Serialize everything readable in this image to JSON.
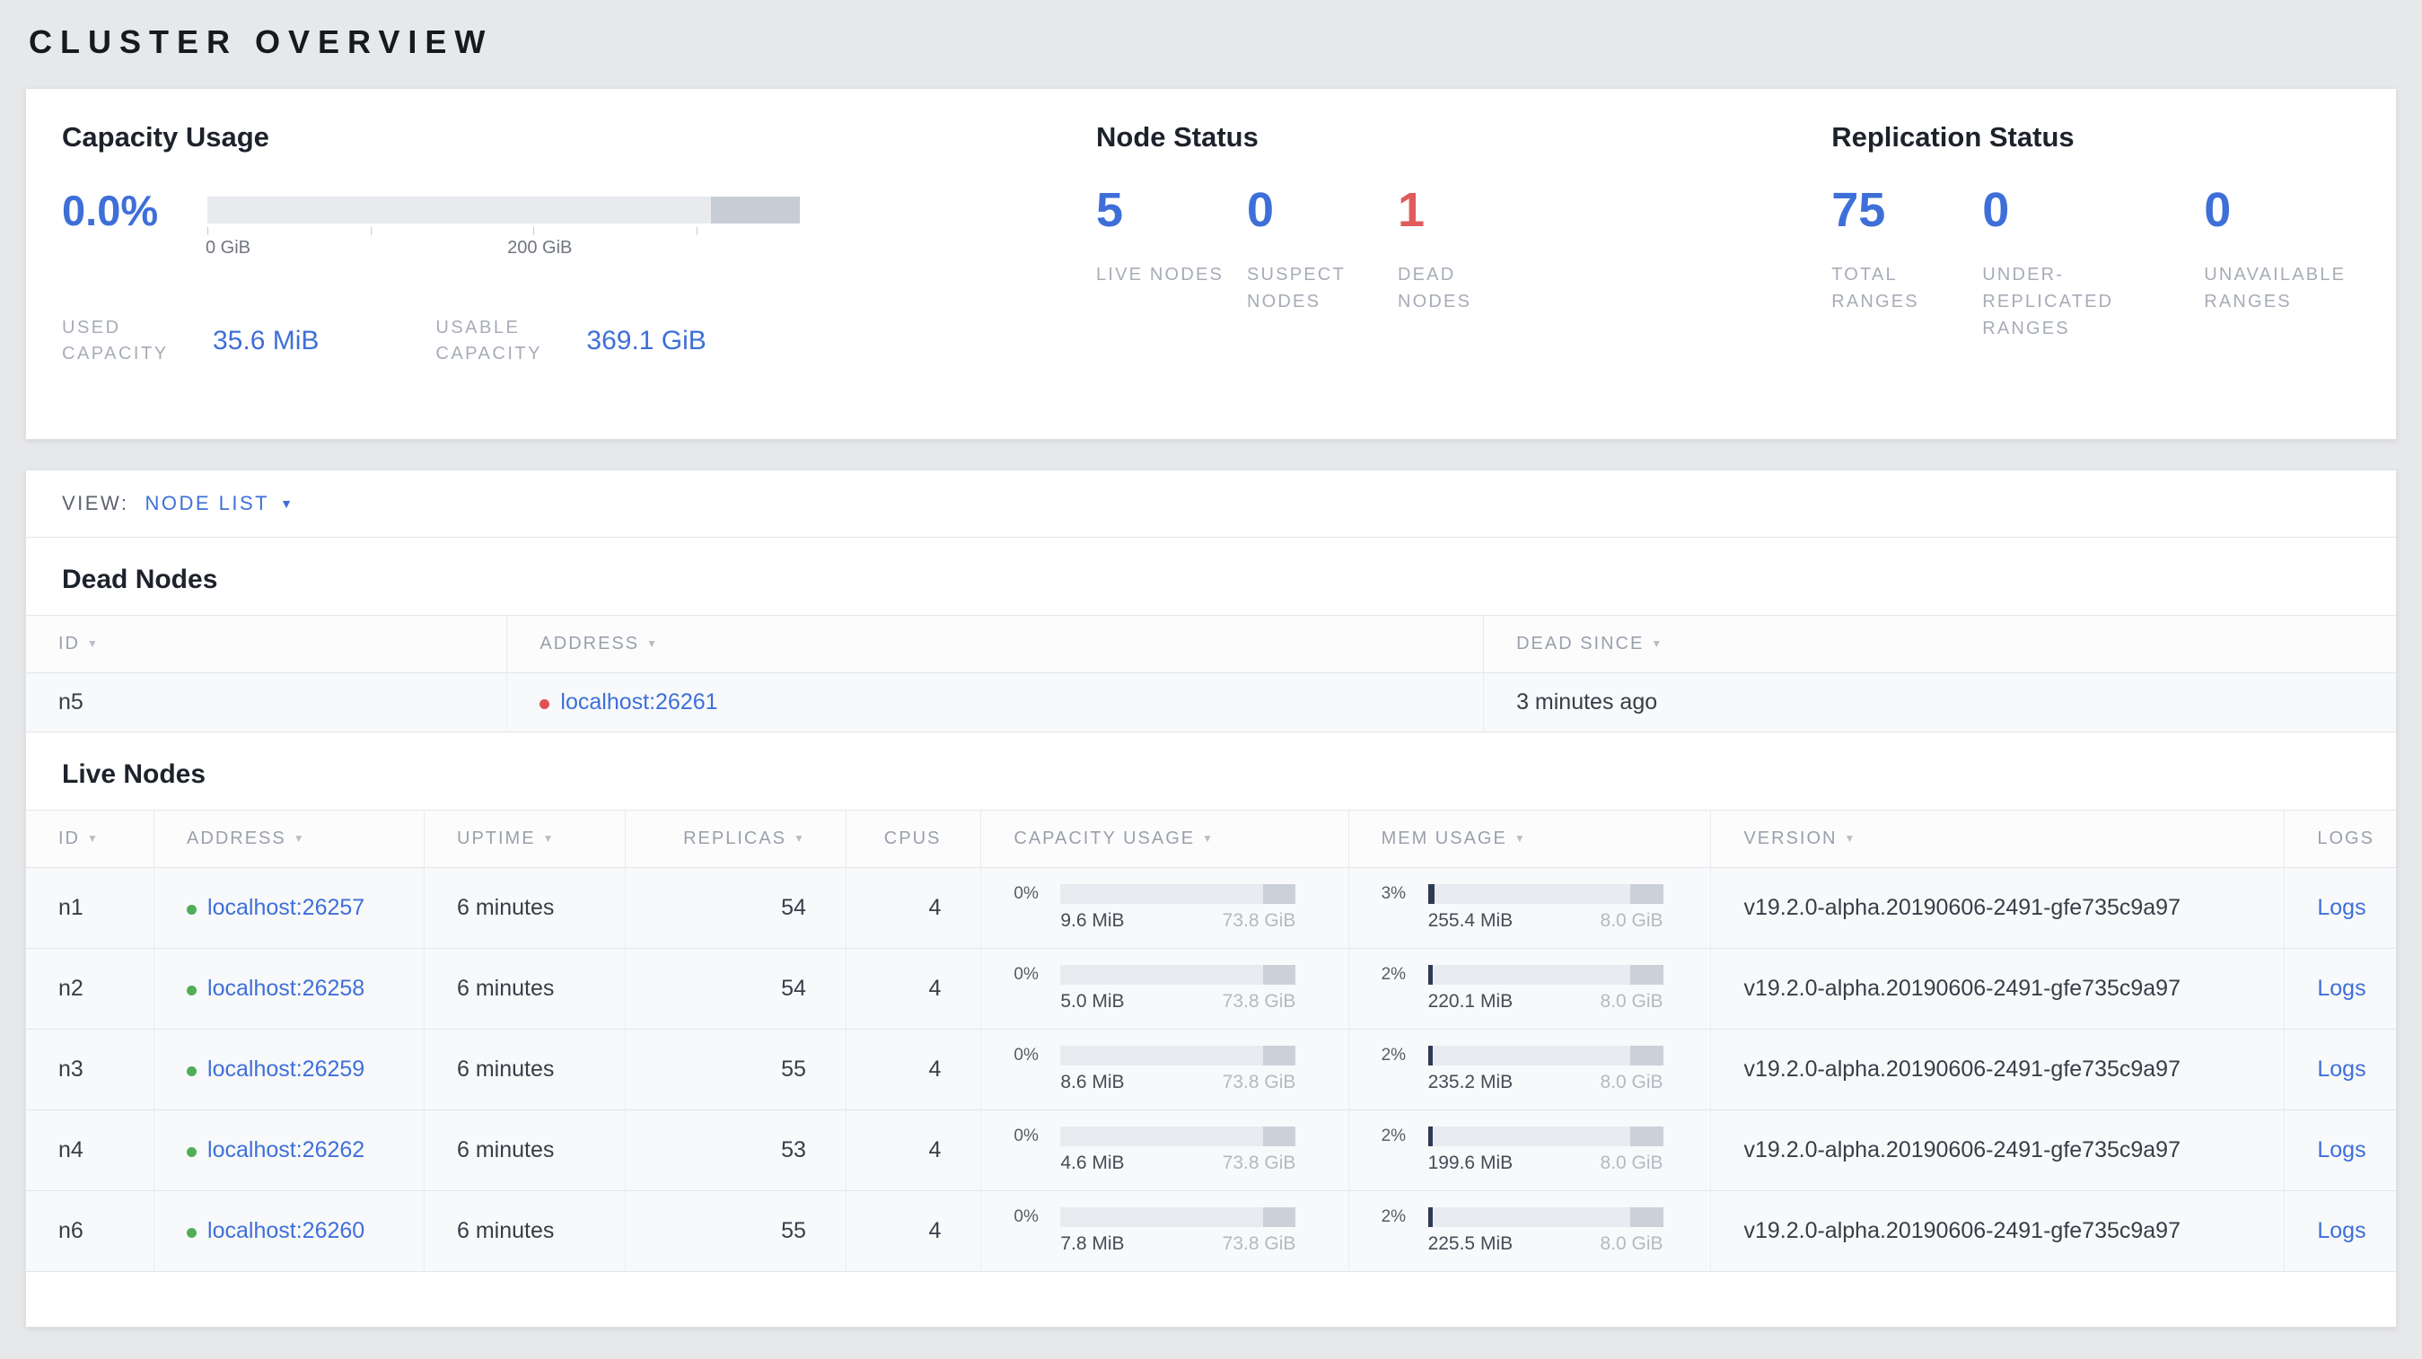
{
  "page": {
    "title": "CLUSTER OVERVIEW"
  },
  "icons": {
    "sort_desc": "▼",
    "caret_down": "▼"
  },
  "colors": {
    "accent_blue": "#3e6fd9",
    "danger_red": "#e05c5c",
    "live_green": "#4fae57",
    "dead_red": "#e05252"
  },
  "summary": {
    "capacity": {
      "title": "Capacity Usage",
      "percent": "0.0%",
      "axis_ticks": [
        "0 GiB",
        "200 GiB"
      ],
      "used_label": "USED CAPACITY",
      "used_value": "35.6 MiB",
      "usable_label": "USABLE CAPACITY",
      "usable_value": "369.1 GiB"
    },
    "node_status": {
      "title": "Node Status",
      "stats": [
        {
          "value": "5",
          "label": "LIVE NODES"
        },
        {
          "value": "0",
          "label": "SUSPECT NODES"
        },
        {
          "value": "1",
          "label": "DEAD NODES"
        }
      ]
    },
    "replication": {
      "title": "Replication Status",
      "stats": [
        {
          "value": "75",
          "label": "TOTAL RANGES"
        },
        {
          "value": "0",
          "label": "UNDER-REPLICATED RANGES"
        },
        {
          "value": "0",
          "label": "UNAVAILABLE RANGES"
        }
      ]
    }
  },
  "view_bar": {
    "label": "VIEW:",
    "selected": "NODE LIST"
  },
  "dead_nodes": {
    "title": "Dead Nodes",
    "columns": [
      "ID",
      "ADDRESS",
      "DEAD SINCE"
    ],
    "rows": [
      {
        "id": "n5",
        "address": "localhost:26261",
        "dead_since": "3 minutes ago"
      }
    ]
  },
  "live_nodes": {
    "title": "Live Nodes",
    "columns": [
      "ID",
      "ADDRESS",
      "UPTIME",
      "REPLICAS",
      "CPUS",
      "CAPACITY USAGE",
      "MEM USAGE",
      "VERSION",
      "LOGS"
    ],
    "rows": [
      {
        "id": "n1",
        "address": "localhost:26257",
        "uptime": "6 minutes",
        "replicas": "54",
        "cpus": "4",
        "cap_pct": "0%",
        "cap_used": "9.6 MiB",
        "cap_total": "73.8 GiB",
        "mem_pct": "3%",
        "mem_used": "255.4 MiB",
        "mem_total": "8.0 GiB",
        "version": "v19.2.0-alpha.20190606-2491-gfe735c9a97",
        "logs": "Logs"
      },
      {
        "id": "n2",
        "address": "localhost:26258",
        "uptime": "6 minutes",
        "replicas": "54",
        "cpus": "4",
        "cap_pct": "0%",
        "cap_used": "5.0 MiB",
        "cap_total": "73.8 GiB",
        "mem_pct": "2%",
        "mem_used": "220.1 MiB",
        "mem_total": "8.0 GiB",
        "version": "v19.2.0-alpha.20190606-2491-gfe735c9a97",
        "logs": "Logs"
      },
      {
        "id": "n3",
        "address": "localhost:26259",
        "uptime": "6 minutes",
        "replicas": "55",
        "cpus": "4",
        "cap_pct": "0%",
        "cap_used": "8.6 MiB",
        "cap_total": "73.8 GiB",
        "mem_pct": "2%",
        "mem_used": "235.2 MiB",
        "mem_total": "8.0 GiB",
        "version": "v19.2.0-alpha.20190606-2491-gfe735c9a97",
        "logs": "Logs"
      },
      {
        "id": "n4",
        "address": "localhost:26262",
        "uptime": "6 minutes",
        "replicas": "53",
        "cpus": "4",
        "cap_pct": "0%",
        "cap_used": "4.6 MiB",
        "cap_total": "73.8 GiB",
        "mem_pct": "2%",
        "mem_used": "199.6 MiB",
        "mem_total": "8.0 GiB",
        "version": "v19.2.0-alpha.20190606-2491-gfe735c9a97",
        "logs": "Logs"
      },
      {
        "id": "n6",
        "address": "localhost:26260",
        "uptime": "6 minutes",
        "replicas": "55",
        "cpus": "4",
        "cap_pct": "0%",
        "cap_used": "7.8 MiB",
        "cap_total": "73.8 GiB",
        "mem_pct": "2%",
        "mem_used": "225.5 MiB",
        "mem_total": "8.0 GiB",
        "version": "v19.2.0-alpha.20190606-2491-gfe735c9a97",
        "logs": "Logs"
      }
    ]
  }
}
